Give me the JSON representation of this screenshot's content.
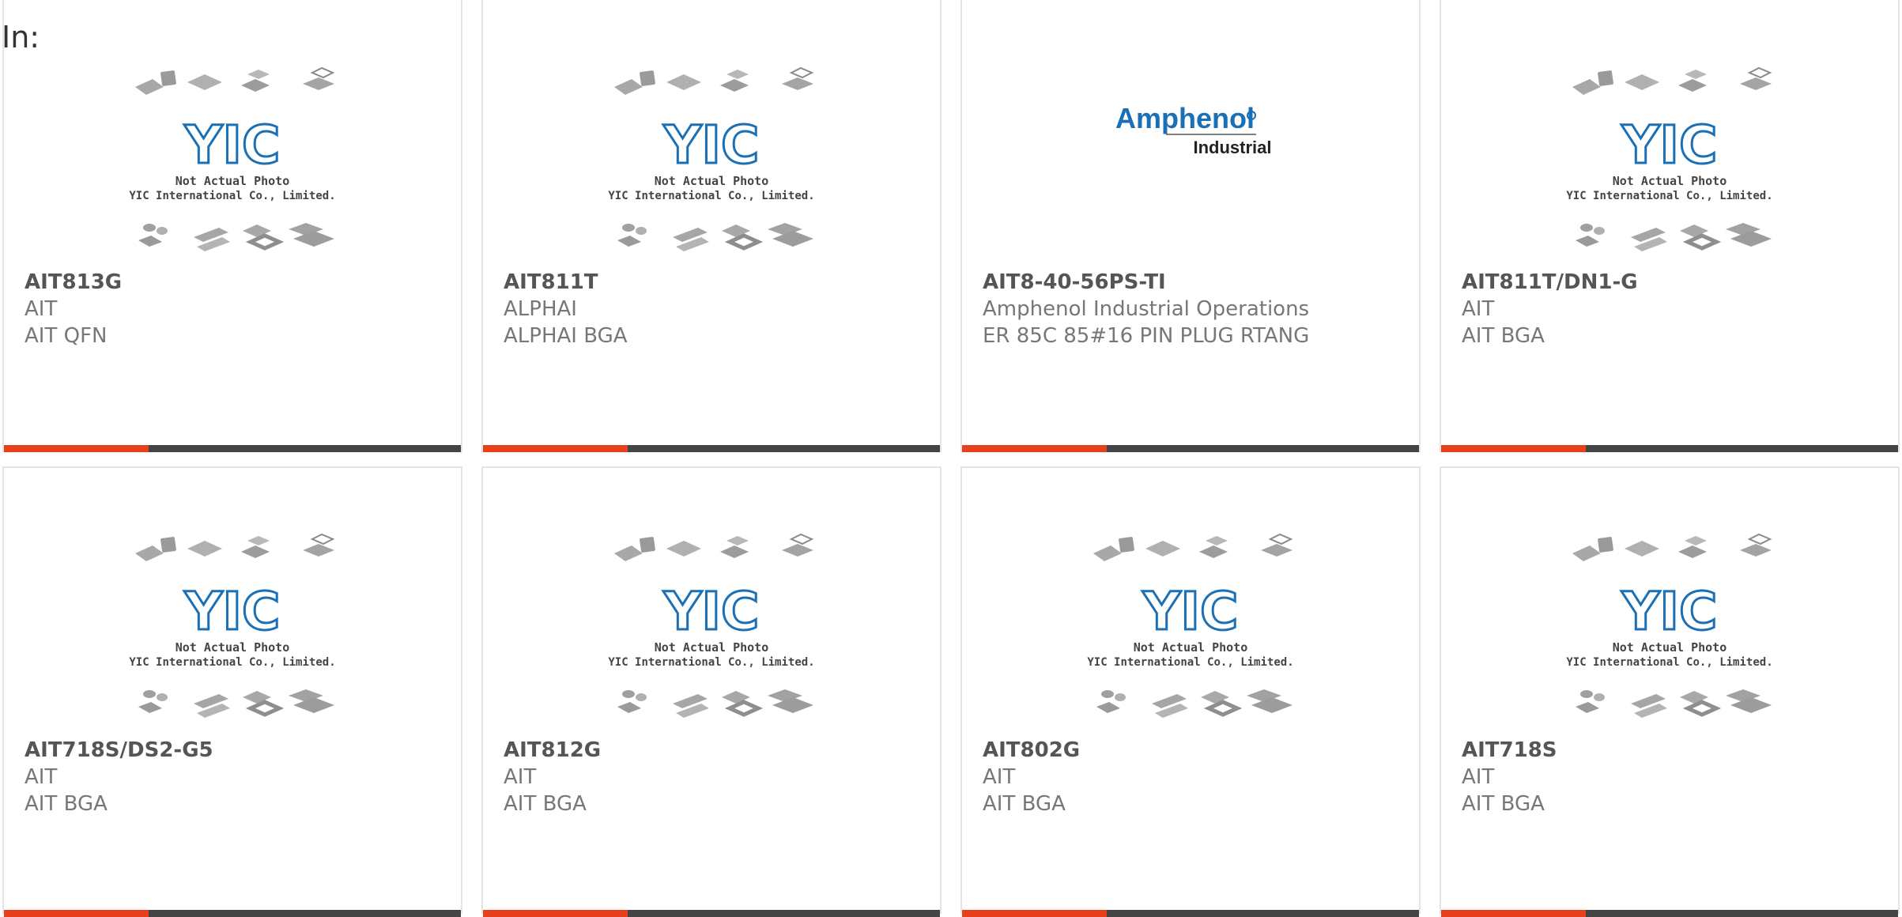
{
  "header": {
    "in_label": "In:"
  },
  "placeholder": {
    "logo_text": "YIC",
    "line1": "Not Actual Photo",
    "line2": "YIC International Co., Limited."
  },
  "brand_logo": {
    "name": "Amphenol",
    "sub": "Industrial"
  },
  "colors": {
    "accent": "#e8401c",
    "bar": "#444444",
    "logo_blue": "#1a6fb5"
  },
  "products": [
    {
      "part": "AIT813G",
      "mfr": "AIT",
      "desc": "AIT QFN",
      "image": "placeholder"
    },
    {
      "part": "AIT811T",
      "mfr": "ALPHAI",
      "desc": "ALPHAI BGA",
      "image": "placeholder"
    },
    {
      "part": "AIT8-40-56PS-TI",
      "mfr": "Amphenol Industrial Operations",
      "desc": "ER 85C 85#16 PIN PLUG RTANG",
      "image": "brand-logo"
    },
    {
      "part": "AIT811T/DN1-G",
      "mfr": "AIT",
      "desc": "AIT BGA",
      "image": "placeholder"
    },
    {
      "part": "AIT718S/DS2-G5",
      "mfr": "AIT",
      "desc": "AIT BGA",
      "image": "placeholder"
    },
    {
      "part": "AIT812G",
      "mfr": "AIT",
      "desc": "AIT BGA",
      "image": "placeholder"
    },
    {
      "part": "AIT802G",
      "mfr": "AIT",
      "desc": "AIT BGA",
      "image": "placeholder"
    },
    {
      "part": "AIT718S",
      "mfr": "AIT",
      "desc": "AIT BGA",
      "image": "placeholder"
    }
  ]
}
